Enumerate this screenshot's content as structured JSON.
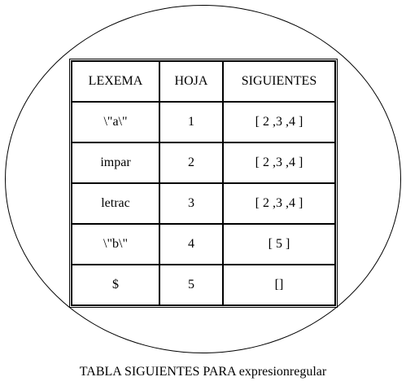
{
  "table": {
    "headers": [
      "LEXEMA",
      "HOJA",
      "SIGUIENTES"
    ],
    "rows": [
      [
        "\\\"a\\\"",
        "1",
        "[ 2 ,3 ,4 ]"
      ],
      [
        "impar",
        "2",
        "[ 2 ,3 ,4 ]"
      ],
      [
        "letrac",
        "3",
        "[ 2 ,3 ,4 ]"
      ],
      [
        "\\\"b\\\"",
        "4",
        "[ 5 ]"
      ],
      [
        "$",
        "5",
        "[]"
      ]
    ]
  },
  "caption": "TABLA SIGUIENTES PARA expresionregular"
}
